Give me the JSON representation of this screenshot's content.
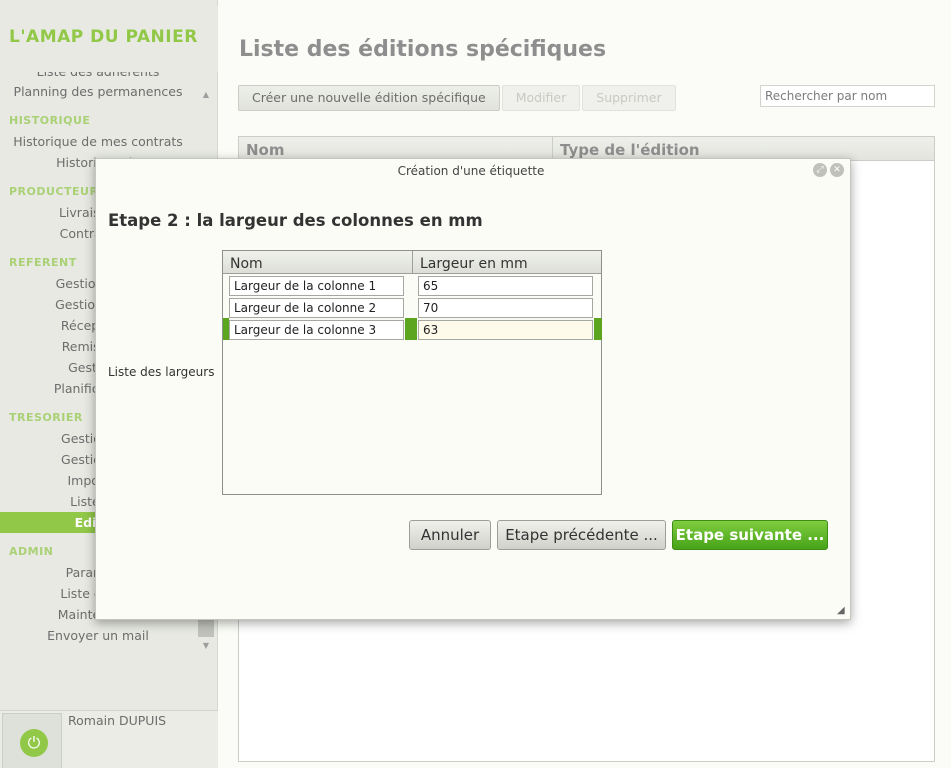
{
  "app": {
    "brand": "L'AMAP DU PANIER"
  },
  "sidebar": {
    "items": [
      {
        "type": "cut",
        "label": "Liste des adhérents"
      },
      {
        "type": "item",
        "label": "Planning des permanences"
      },
      {
        "type": "section",
        "label": "HISTORIQUE"
      },
      {
        "type": "item",
        "label": "Historique de mes contrats"
      },
      {
        "type": "item",
        "label": "Historique de"
      },
      {
        "type": "section",
        "label": "PRODUCTEUR"
      },
      {
        "type": "item",
        "label": "Livraisons d'"
      },
      {
        "type": "item",
        "label": "Contrats d'u"
      },
      {
        "type": "section",
        "label": "REFERENT"
      },
      {
        "type": "item",
        "label": "Gestion des c"
      },
      {
        "type": "item",
        "label": "Gestion des d"
      },
      {
        "type": "item",
        "label": "Réception d"
      },
      {
        "type": "item",
        "label": "Remise aux"
      },
      {
        "type": "item",
        "label": "Gestion d"
      },
      {
        "type": "item",
        "label": "Planification d"
      },
      {
        "type": "section",
        "label": "TRESORIER"
      },
      {
        "type": "item",
        "label": "Gestion des"
      },
      {
        "type": "item",
        "label": "Gestion des"
      },
      {
        "type": "item",
        "label": "Import de"
      },
      {
        "type": "item",
        "label": "Liste des"
      },
      {
        "type": "active",
        "label": "Editions s"
      },
      {
        "type": "section",
        "label": "ADMIN"
      },
      {
        "type": "item",
        "label": "Paramètre"
      },
      {
        "type": "item",
        "label": "Liste des ad"
      },
      {
        "type": "item",
        "label": "Maintenance"
      },
      {
        "type": "item",
        "label": "Envoyer un mail"
      }
    ],
    "user_name": "Romain DUPUIS",
    "power_icon": "⏻"
  },
  "main": {
    "title": "Liste des éditions spécifiques",
    "toolbar": {
      "create_label": "Créer une nouvelle édition spécifique",
      "edit_label": "Modifier",
      "delete_label": "Supprimer"
    },
    "search_placeholder": "Rechercher par nom",
    "grid": {
      "col_name": "Nom",
      "col_type": "Type de l'édition"
    }
  },
  "dialog": {
    "title": "Création d'une étiquette",
    "step_title": "Etape 2 : la largeur des colonnes en mm",
    "list_label": "Liste des largeurs",
    "table": {
      "col_name": "Nom",
      "col_width": "Largeur en mm",
      "rows": [
        {
          "name": "Largeur de la colonne 1",
          "width": "65"
        },
        {
          "name": "Largeur de la colonne 2",
          "width": "70"
        },
        {
          "name": "Largeur de la colonne 3",
          "width": "63"
        }
      ]
    },
    "buttons": {
      "cancel": "Annuler",
      "previous": "Etape précédente ...",
      "next": "Etape suivante ..."
    },
    "icons": {
      "maximize": "⤢",
      "close": "✕",
      "resize": "◢"
    }
  },
  "colors": {
    "accent": "#8dc63f",
    "selection": "#5ca61f"
  }
}
